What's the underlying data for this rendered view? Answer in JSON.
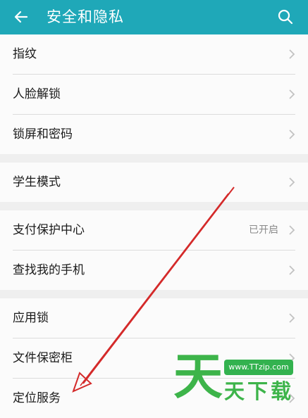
{
  "header": {
    "title": "安全和隐私",
    "back_icon": "back-arrow-icon",
    "search_icon": "search-icon"
  },
  "groups": [
    {
      "items": [
        {
          "label": "指纹"
        },
        {
          "label": "人脸解锁"
        },
        {
          "label": "锁屏和密码"
        }
      ]
    },
    {
      "items": [
        {
          "label": "学生模式"
        }
      ]
    },
    {
      "items": [
        {
          "label": "支付保护中心",
          "value": "已开启"
        },
        {
          "label": "查找我的手机"
        }
      ]
    },
    {
      "items": [
        {
          "label": "应用锁"
        },
        {
          "label": "文件保密柜"
        },
        {
          "label": "定位服务"
        }
      ]
    }
  ],
  "watermark": {
    "site": "www.TTzip.com",
    "big_char": "天",
    "text": "天下载"
  },
  "colors": {
    "appbar": "#1fa8b8",
    "annotation_arrow": "#d42a2a",
    "watermark_green": "#3db44a"
  }
}
